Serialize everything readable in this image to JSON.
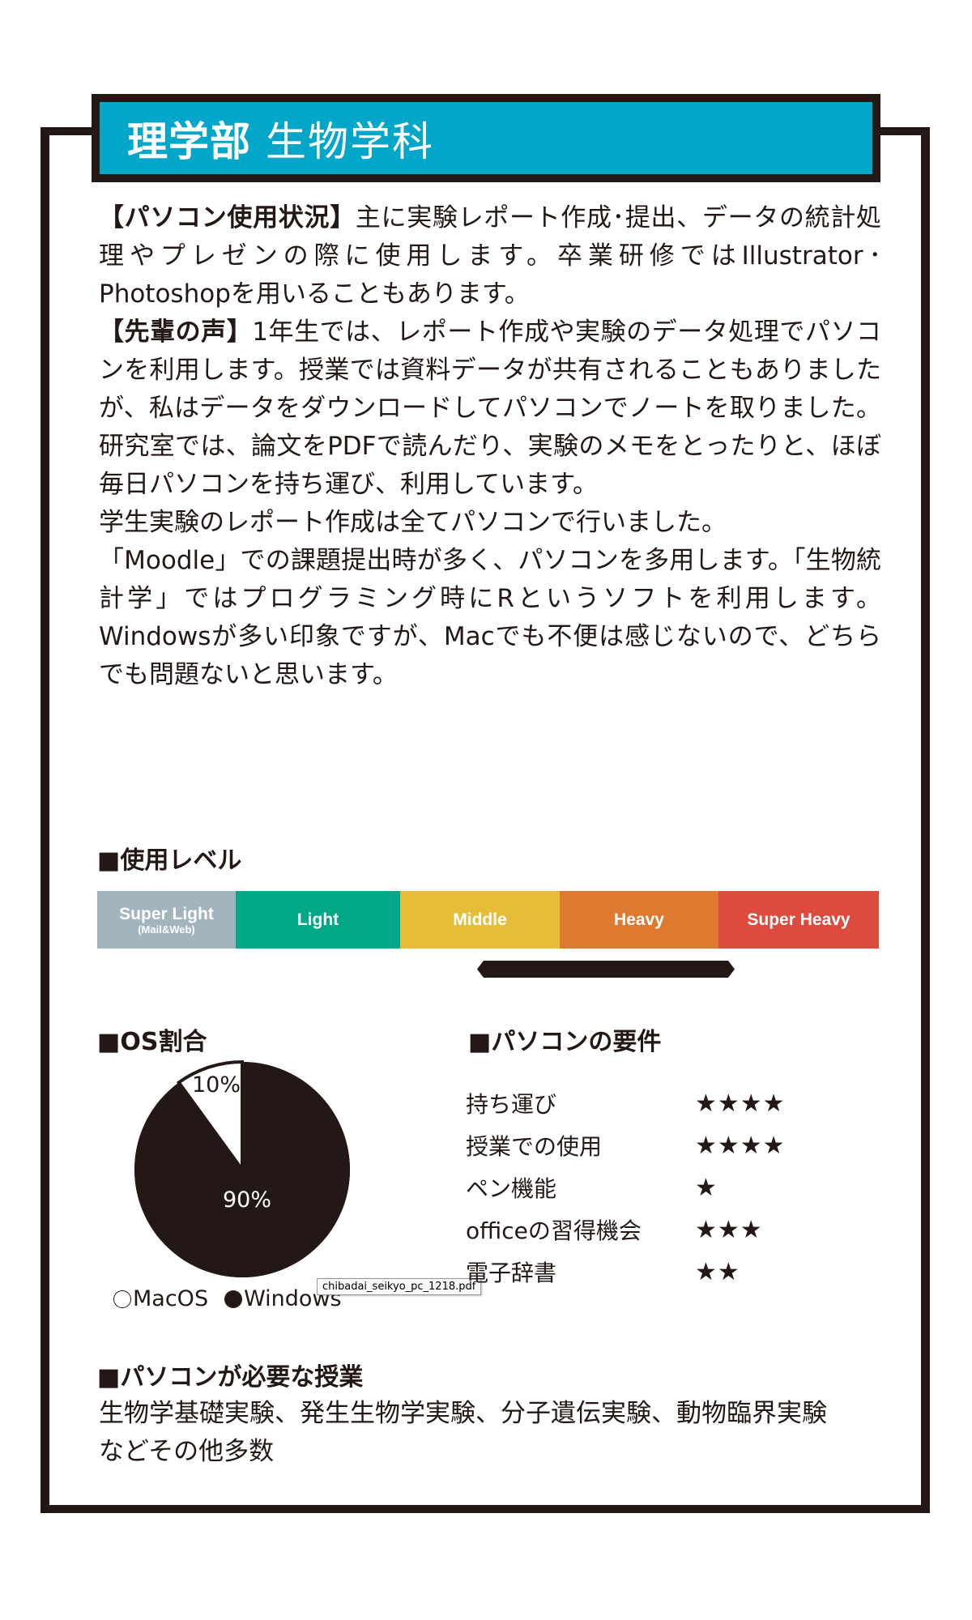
{
  "header": {
    "faculty": "理学部",
    "department": "生物学科",
    "background_color": "#02a6c9"
  },
  "body": {
    "paragraphs": [
      {
        "label": "【パソコン使用状況】",
        "text": "主に実験レポート作成･提出、データの統計処理やプレゼンの際に使用します。卒業研修ではIllustrator･Photoshopを用いることもあります。"
      },
      {
        "label": "【先輩の声】",
        "text": "1年生では、レポート作成や実験のデータ処理でパソコンを利用します。授業では資料データが共有されることもありましたが、私はデータをダウンロードしてパソコンでノートを取りました。研究室では、論文をPDFで読んだり、実験のメモをとったりと、ほぼ毎日パソコンを持ち運び、利用しています。"
      },
      {
        "label": "",
        "text": "学生実験のレポート作成は全てパソコンで行いました。"
      },
      {
        "label": "",
        "text": "「Moodle」での課題提出時が多く、パソコンを多用します。「生物統計学」ではプログラミング時にRというソフトを利用します。Windowsが多い印象ですが、Macでも不便は感じないので、どちらでも問題ないと思います。"
      }
    ]
  },
  "usage_level": {
    "heading": "■使用レベル",
    "levels": [
      {
        "label": "Super Light",
        "sublabel": "(Mail&Web)",
        "color": "#a2b5bf"
      },
      {
        "label": "Light",
        "sublabel": "",
        "color": "#00a887"
      },
      {
        "label": "Middle",
        "sublabel": "",
        "color": "#e6bd38"
      },
      {
        "label": "Heavy",
        "sublabel": "",
        "color": "#de7a30"
      },
      {
        "label": "Super Heavy",
        "sublabel": "",
        "color": "#dc4b3e"
      }
    ],
    "selected_range": {
      "from": "Middle",
      "to": "Heavy",
      "from_fraction": 0.49,
      "to_fraction": 0.818
    }
  },
  "os_share": {
    "heading": "■OS割合",
    "legend": [
      {
        "glyph": "○",
        "label": "MacOS"
      },
      {
        "glyph": "●",
        "label": "Windows"
      }
    ]
  },
  "chart_data": {
    "type": "pie",
    "title": "OS割合",
    "categories": [
      "MacOS",
      "Windows"
    ],
    "values": [
      10,
      90
    ],
    "labels": [
      "10%",
      "90%"
    ],
    "colors": [
      "#ffffff",
      "#231815"
    ],
    "legend_position": "bottom"
  },
  "tooltip": {
    "text": "chibadai_seikyo_pc_1218.pdf"
  },
  "requirements": {
    "heading": "■パソコンの要件",
    "max_stars": 4,
    "items": [
      {
        "label": "持ち運び",
        "stars": 4,
        "display": "★★★★"
      },
      {
        "label": "授業での使用",
        "stars": 4,
        "display": "★★★★"
      },
      {
        "label": "ペン機能",
        "stars": 1,
        "display": "★"
      },
      {
        "label": "officeの習得機会",
        "stars": 3,
        "display": "★★★"
      },
      {
        "label": "電子辞書",
        "stars": 2,
        "display": "★★"
      }
    ]
  },
  "required_courses": {
    "heading": "■パソコンが必要な授業",
    "lines": [
      "生物学基礎実験、発生生物学実験、分子遺伝実験、動物臨界実験",
      "などその他多数"
    ]
  }
}
